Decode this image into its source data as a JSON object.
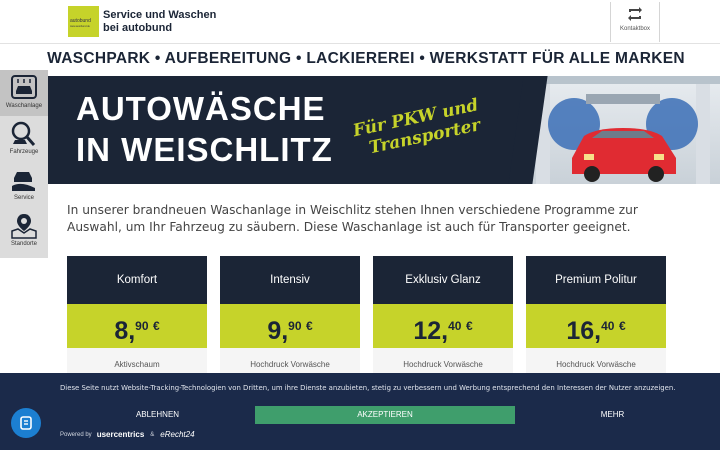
{
  "header": {
    "brand_line1": "Service und Waschen",
    "brand_line2": "bei autobund",
    "logo_text": "autobund",
    "logo_sub": "www.autobund.de",
    "contact_label": "Kontaktbox",
    "contact_icon": "refresh-icon"
  },
  "nav": {
    "services": "WASCHPARK • AUFBEREITUNG • LACKIEREREI • WERKSTATT FÜR ALLE MARKEN"
  },
  "sidebar": {
    "items": [
      {
        "label": "Waschanlage",
        "icon": "car-wash-icon",
        "active": true
      },
      {
        "label": "Fahrzeuge",
        "icon": "car-search-icon",
        "active": false
      },
      {
        "label": "Service",
        "icon": "car-service-icon",
        "active": false
      },
      {
        "label": "Standorte",
        "icon": "map-pin-icon",
        "active": false
      }
    ]
  },
  "hero": {
    "title_line1": "AUTOWÄSCHE",
    "title_line2": "IN WEISCHLITZ",
    "script_line1": "Für PKW und",
    "script_line2": "Transporter"
  },
  "intro": "In unserer brandneuen Waschanlage in Weischlitz stehen Ihnen verschiedene Programme zur Auswahl, um Ihr Fahrzeug zu säubern. Diese Waschanlage ist auch für Transporter geeignet.",
  "programs": [
    {
      "name": "Komfort",
      "price_main": "8,",
      "price_cents": "90",
      "currency": "€",
      "first_feature": "Aktivschaum"
    },
    {
      "name": "Intensiv",
      "price_main": "9,",
      "price_cents": "90",
      "currency": "€",
      "first_feature": "Hochdruck Vorwäsche"
    },
    {
      "name": "Exklusiv Glanz",
      "price_main": "12,",
      "price_cents": "40",
      "currency": "€",
      "first_feature": "Hochdruck Vorwäsche"
    },
    {
      "name": "Premium Politur",
      "price_main": "16,",
      "price_cents": "40",
      "currency": "€",
      "first_feature": "Hochdruck Vorwäsche"
    }
  ],
  "cookie": {
    "text": "Diese Seite nutzt Website-Tracking-Technologien von Dritten, um ihre Dienste anzubieten, stetig zu verbessern und Werbung entsprechend den Interessen der Nutzer anzuzeigen.",
    "reject_label": "ABLEHNEN",
    "accept_label": "AKZEPTIEREN",
    "more_label": "MEHR",
    "powered_by": "Powered by",
    "provider": "usercentrics",
    "amp": "&",
    "partner": "eRecht24"
  },
  "colors": {
    "navy": "#1b2536",
    "lime": "#c6d32a",
    "cookie_bg": "#1b2a4a",
    "accept_green": "#3f9e6c",
    "fab_blue": "#1c7fd1"
  }
}
